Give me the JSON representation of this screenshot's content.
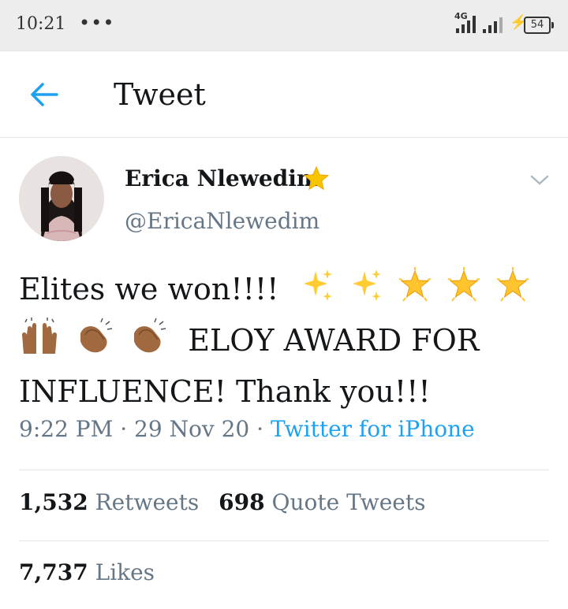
{
  "status_bar": {
    "time": "10:21",
    "dots": "•••",
    "network": "4G",
    "battery": "54"
  },
  "header": {
    "title": "Tweet"
  },
  "author": {
    "name": "Erica Nlewedim",
    "handle": "@EricaNlewedim"
  },
  "tweet": {
    "line1": "Elites we won!!!!",
    "line2": "ELOY AWARD FOR",
    "line3": "INFLUENCE! Thank you!!!",
    "emoji_icons": [
      "sparkles-icon",
      "sparkles-icon",
      "glowing-star-icon",
      "glowing-star-icon",
      "glowing-star-icon",
      "raising-hands-icon",
      "clapping-hands-icon",
      "clapping-hands-icon"
    ]
  },
  "meta": {
    "time": "9:22 PM",
    "sep": "·",
    "date": "29 Nov 20",
    "source": "Twitter for iPhone"
  },
  "stats": {
    "retweets_count": "1,532",
    "retweets_label": "Retweets",
    "quotes_count": "698",
    "quotes_label": "Quote Tweets",
    "likes_count": "7,737",
    "likes_label": "Likes"
  },
  "colors": {
    "accent": "#1da1f2",
    "text": "#14171a",
    "muted": "#657786",
    "star": "#f7c600"
  }
}
